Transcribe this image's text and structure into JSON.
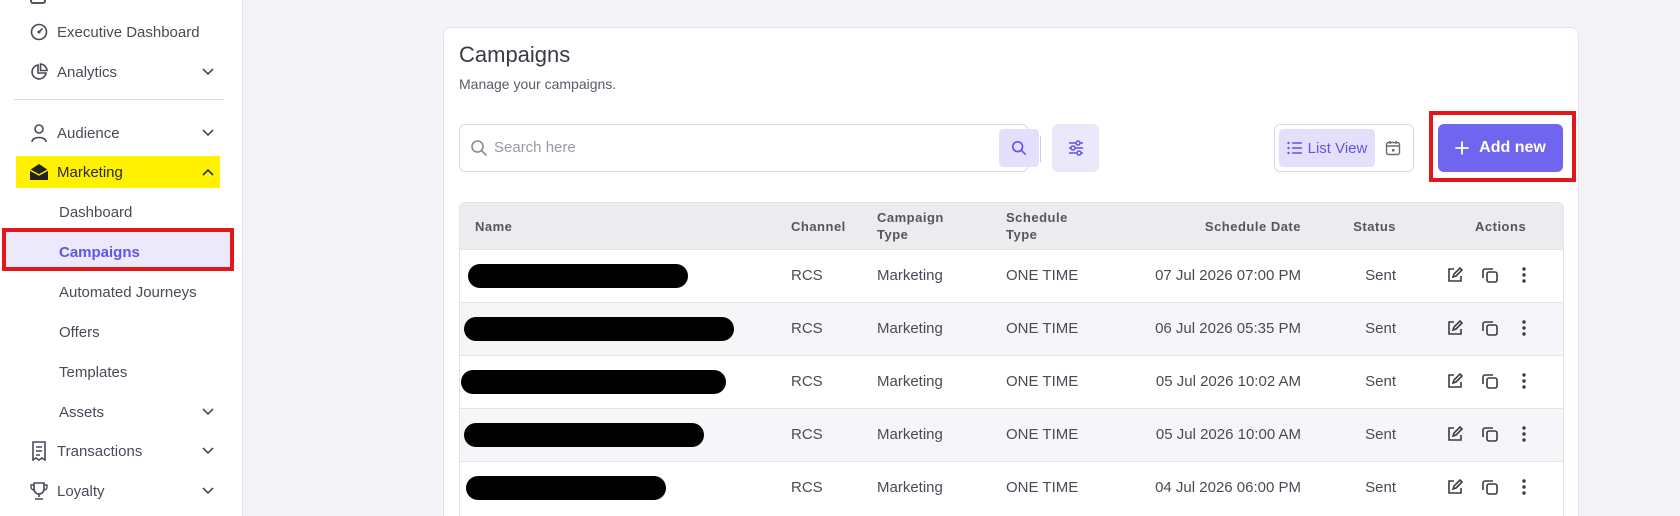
{
  "sidebar": {
    "items": [
      {
        "label": "Executive Dashboard",
        "icon": "gauge-icon"
      },
      {
        "label": "Analytics",
        "icon": "pie-chart-icon"
      },
      {
        "label": "Audience",
        "icon": "user-icon"
      },
      {
        "label": "Marketing",
        "icon": "envelope-icon"
      },
      {
        "label": "Transactions",
        "icon": "receipt-icon"
      },
      {
        "label": "Loyalty",
        "icon": "trophy-icon"
      }
    ],
    "marketing_sub": [
      {
        "label": "Dashboard"
      },
      {
        "label": "Campaigns"
      },
      {
        "label": "Automated Journeys"
      },
      {
        "label": "Offers"
      },
      {
        "label": "Templates"
      },
      {
        "label": "Assets"
      }
    ]
  },
  "page": {
    "title": "Campaigns",
    "subtitle": "Manage your campaigns."
  },
  "toolbar": {
    "search_placeholder": "Search here",
    "list_view_label": "List View",
    "add_new_label": "Add new"
  },
  "table": {
    "headers": {
      "name": "Name",
      "channel": "Channel",
      "campaign_type": [
        "Campaign",
        "Type"
      ],
      "schedule_type": [
        "Schedule",
        "Type"
      ],
      "schedule_date": "Schedule Date",
      "status": "Status",
      "actions": "Actions"
    },
    "rows": [
      {
        "channel": "RCS",
        "type": "Marketing",
        "schedule": "ONE TIME",
        "date": "07 Jul 2026 07:00 PM",
        "status": "Sent"
      },
      {
        "channel": "RCS",
        "type": "Marketing",
        "schedule": "ONE TIME",
        "date": "06 Jul 2026 05:35 PM",
        "status": "Sent"
      },
      {
        "channel": "RCS",
        "type": "Marketing",
        "schedule": "ONE TIME",
        "date": "05 Jul 2026 10:02 AM",
        "status": "Sent"
      },
      {
        "channel": "RCS",
        "type": "Marketing",
        "schedule": "ONE TIME",
        "date": "05 Jul 2026 10:00 AM",
        "status": "Sent"
      },
      {
        "channel": "RCS",
        "type": "Marketing",
        "schedule": "ONE TIME",
        "date": "04 Jul 2026 06:00 PM",
        "status": "Sent"
      }
    ]
  },
  "colors": {
    "accent": "#7065ee",
    "highlight": "#fff100",
    "annotation_red": "#e3161c"
  }
}
